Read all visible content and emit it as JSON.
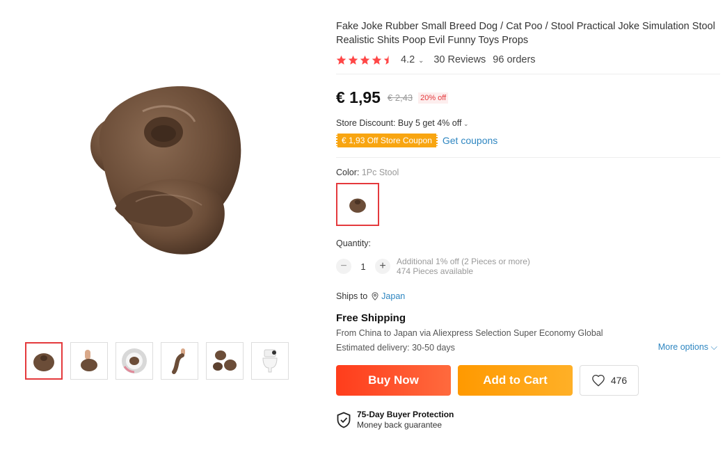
{
  "product": {
    "title": "Fake Joke Rubber Small Breed Dog / Cat Poo / Stool Practical Joke Simulation Stool Realistic Shits Poop Evil Funny Toys Props",
    "rating": "4.2",
    "rating_stars_fraction": 0.84,
    "reviews": "30 Reviews",
    "orders": "96 orders"
  },
  "gallery": {
    "main_image": "poop-toy-photo",
    "thumbnails": [
      {
        "name": "thumb-poop-front",
        "active": true
      },
      {
        "name": "thumb-hand-holding"
      },
      {
        "name": "thumb-in-toilet"
      },
      {
        "name": "thumb-dangling"
      },
      {
        "name": "thumb-multiple-pieces"
      },
      {
        "name": "thumb-toilet"
      }
    ]
  },
  "pricing": {
    "price": "€ 1,95",
    "old_price": "€ 2,43",
    "discount_badge": "20% off",
    "store_discount": "Store Discount: Buy 5 get 4% off",
    "coupon": "€ 1,93 Off Store Coupon",
    "get_coupons": "Get coupons"
  },
  "variant": {
    "color_label": "Color:",
    "color_value": "1Pc Stool"
  },
  "quantity": {
    "label": "Quantity:",
    "value": "1",
    "minus": "−",
    "plus": "+",
    "additional": "Additional 1% off (2 Pieces or more)",
    "available": "474 Pieces available"
  },
  "shipping": {
    "ships_to_label": "Ships to",
    "country": "Japan",
    "free_shipping": "Free Shipping",
    "detail_from": "From ",
    "from_country": "China",
    "detail_to": " to ",
    "to_country": "Japan",
    "detail_via": " via Aliexpress Selection Super Economy Global",
    "delivery": "Estimated delivery: 30-50 days",
    "more_options": "More options"
  },
  "actions": {
    "buy_now": "Buy Now",
    "add_to_cart": "Add to Cart",
    "wishlist_count": "476"
  },
  "protection": {
    "title": "75-Day Buyer Protection",
    "subtitle": "Money back guarantee"
  },
  "colors": {
    "accent_red": "#e4393c",
    "star": "#ff4747",
    "link": "#2e86c1",
    "coupon": "#f8a511",
    "buy_now": "#ff4a25",
    "add_to_cart": "#ffa51a"
  }
}
